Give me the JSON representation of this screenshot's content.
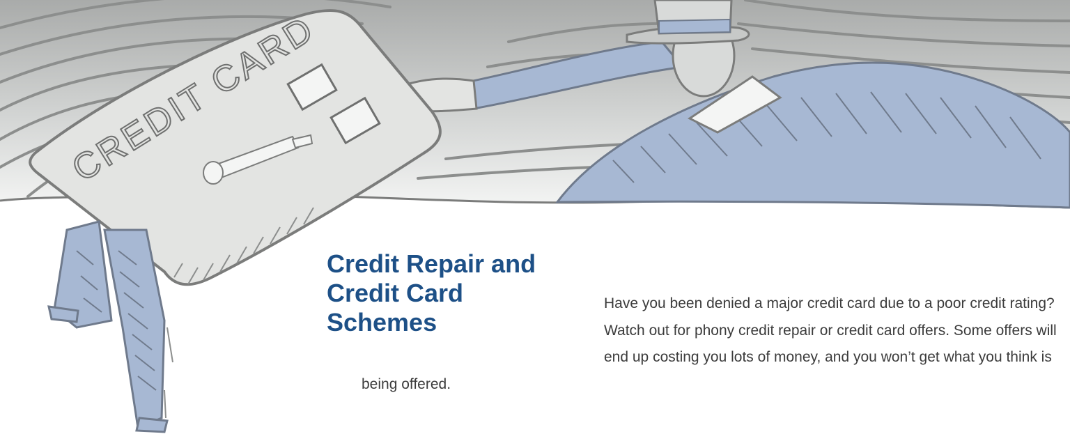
{
  "document": {
    "heading": "Credit Repair and Credit Card Schemes",
    "intro_paragraph": "Have you been denied a major credit card due to a poor credit rating? Watch out for phony credit repair or credit card offers. Some offers will end up costing you lots of money, and you won’t get what you think is being offered."
  },
  "illustration": {
    "card_label": "CREDIT CARD",
    "icon": "credit-card-scheme-illustration",
    "colors": {
      "sky_light": "#ffffff",
      "sky_mid": "#d2d4d3",
      "sky_dark": "#a9abaa",
      "figure_blue": "#a7b8d3",
      "card_gray": "#e3e4e2",
      "line_gray": "#7b7c7b"
    }
  },
  "colors": {
    "heading": "#1d5087",
    "body_text": "#3b3b3b"
  }
}
